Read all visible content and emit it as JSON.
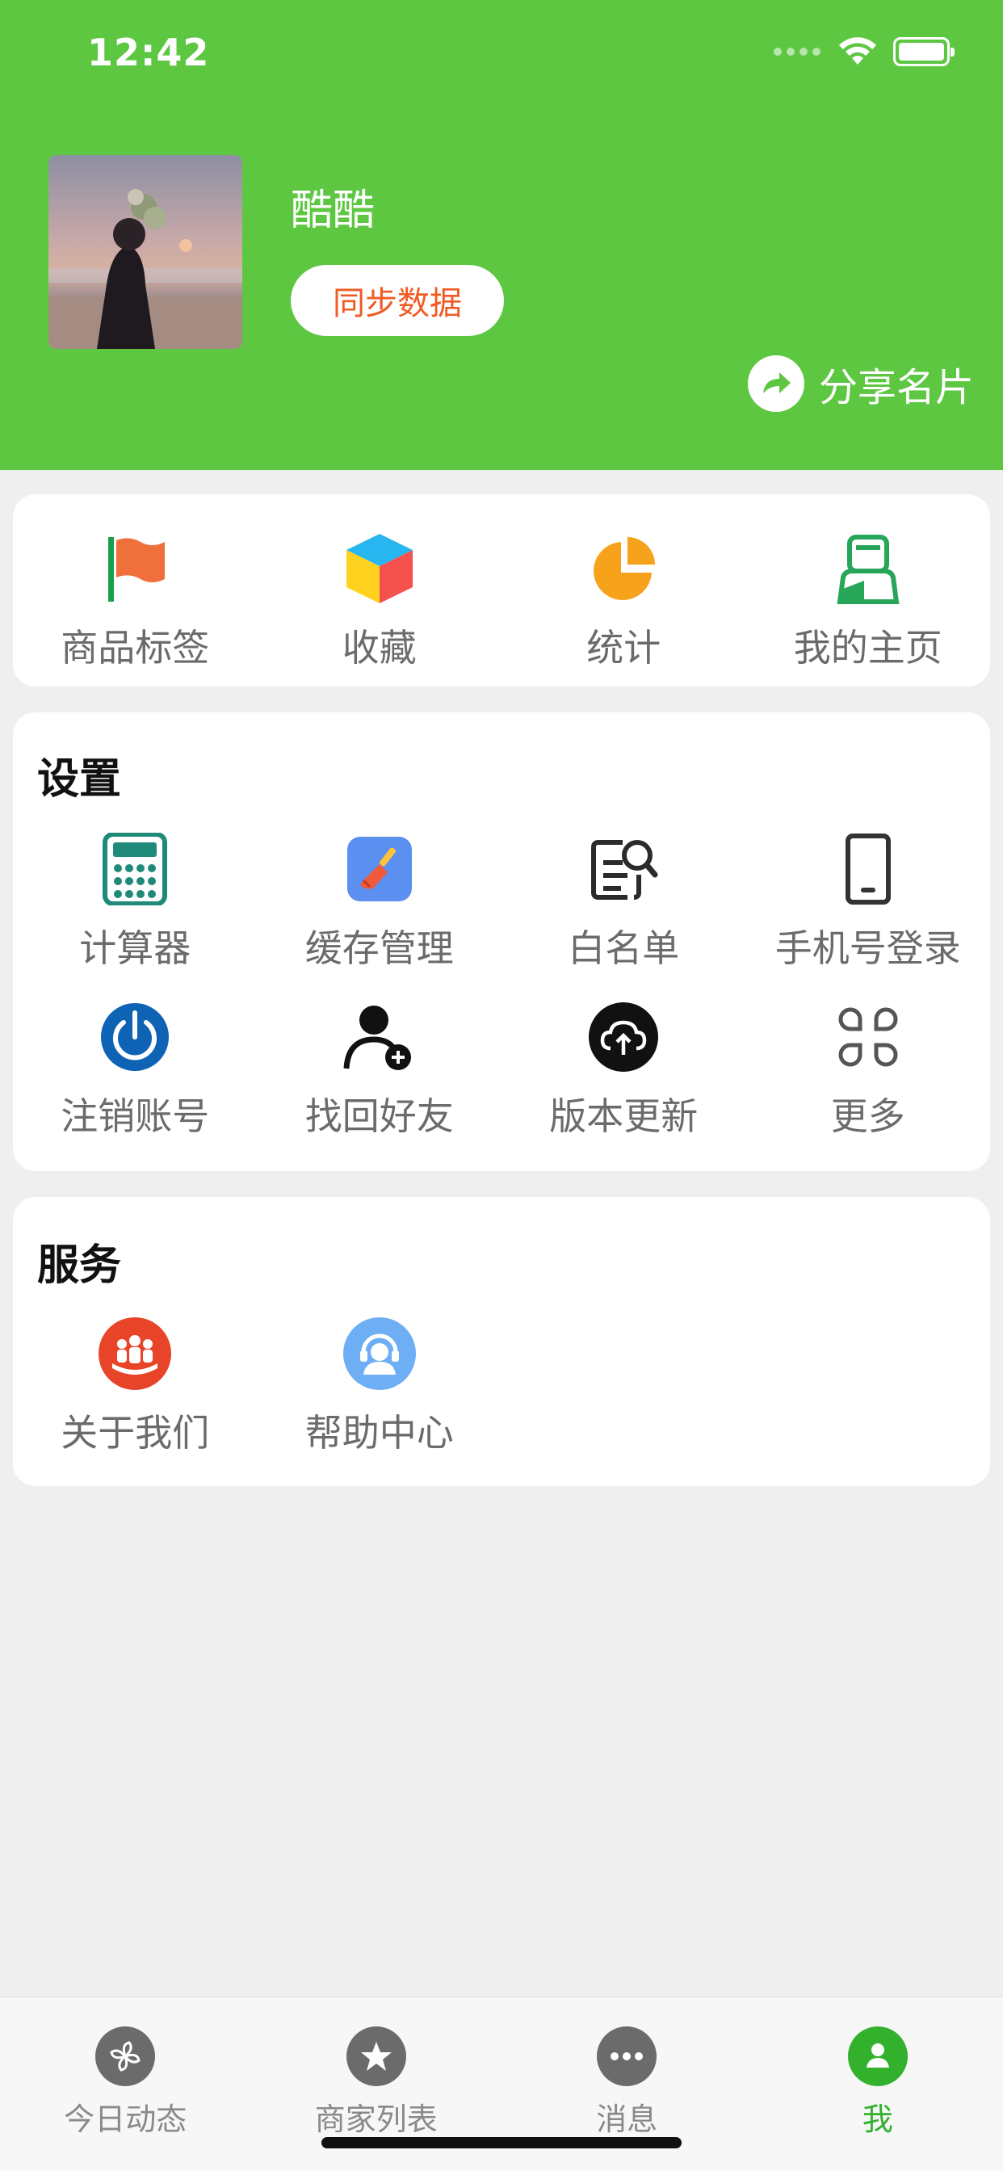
{
  "status_bar": {
    "time": "12:42"
  },
  "profile": {
    "name": "酷酷",
    "sync_label": "同步数据",
    "share_label": "分享名片"
  },
  "quick_actions": [
    {
      "label": "商品标签",
      "icon": "flag-icon"
    },
    {
      "label": "收藏",
      "icon": "cube-icon"
    },
    {
      "label": "统计",
      "icon": "pie-chart-icon"
    },
    {
      "label": "我的主页",
      "icon": "user-page-icon"
    }
  ],
  "settings": {
    "title": "设置",
    "items": [
      {
        "label": "计算器",
        "icon": "calculator-icon"
      },
      {
        "label": "缓存管理",
        "icon": "broom-icon"
      },
      {
        "label": "白名单",
        "icon": "document-search-icon"
      },
      {
        "label": "手机号登录",
        "icon": "phone-icon"
      },
      {
        "label": "注销账号",
        "icon": "power-icon"
      },
      {
        "label": "找回好友",
        "icon": "add-user-icon"
      },
      {
        "label": "版本更新",
        "icon": "cloud-upload-icon"
      },
      {
        "label": "更多",
        "icon": "command-icon"
      }
    ]
  },
  "services": {
    "title": "服务",
    "items": [
      {
        "label": "关于我们",
        "icon": "group-icon"
      },
      {
        "label": "帮助中心",
        "icon": "headset-icon"
      }
    ]
  },
  "tabbar": [
    {
      "label": "今日动态",
      "icon": "pinwheel-icon",
      "active": false
    },
    {
      "label": "商家列表",
      "icon": "star-icon",
      "active": false
    },
    {
      "label": "消息",
      "icon": "chat-dots-icon",
      "active": false
    },
    {
      "label": "我",
      "icon": "person-icon",
      "active": true
    }
  ],
  "colors": {
    "header_green": "#5dc742",
    "sync_text_orange": "#f05b23",
    "active_tab_green": "#33b12c"
  }
}
